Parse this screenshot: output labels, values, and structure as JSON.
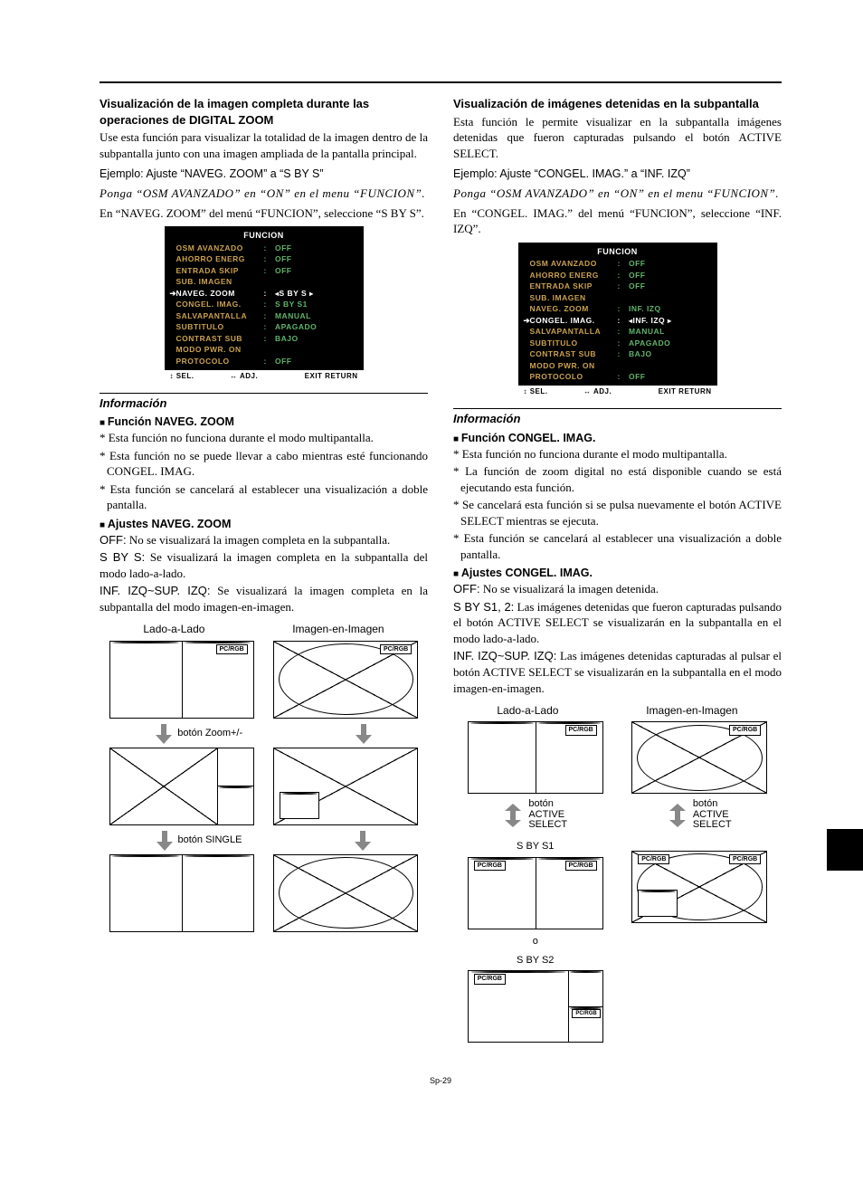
{
  "page_number": "Sp-29",
  "left": {
    "heading": "Visualización de la imagen completa durante las operaciones de DIGITAL ZOOM",
    "intro": "Use esta función para visualizar la totalidad de la imagen dentro de la subpantalla junto con una imagen ampliada de la pantalla principal.",
    "example": "Ejemplo: Ajuste “NAVEG. ZOOM” a “S BY S”",
    "italic": "Ponga “OSM AVANZADO” en “ON” en el menu “FUNCION”.",
    "select": "En “NAVEG. ZOOM” del menú “FUNCION”, seleccione “S BY S”.",
    "menu": {
      "title": "FUNCION",
      "rows": [
        {
          "label": "OSM AVANZADO",
          "value": "OFF",
          "sep": ":"
        },
        {
          "label": "AHORRO ENERG",
          "value": "OFF",
          "sep": ":"
        },
        {
          "label": "ENTRADA SKIP",
          "value": "OFF",
          "sep": ":"
        },
        {
          "label": "SUB. IMAGEN",
          "value": "",
          "sep": ""
        },
        {
          "label": "NAVEG. ZOOM",
          "value": "S BY S",
          "sep": ":",
          "hl": true,
          "arrows": true
        },
        {
          "label": "CONGEL. IMAG.",
          "value": "S BY S1",
          "sep": ":"
        },
        {
          "label": "SALVAPANTALLA",
          "value": "MANUAL",
          "sep": ":"
        },
        {
          "label": "SUBTITULO",
          "value": "APAGADO",
          "sep": ":"
        },
        {
          "label": "CONTRAST SUB",
          "value": "BAJO",
          "sep": ":"
        },
        {
          "label": "MODO PWR. ON",
          "value": "",
          "sep": ""
        },
        {
          "label": "PROTOCOLO",
          "value": "OFF",
          "sep": ":"
        }
      ],
      "foot": {
        "a": "↕ SEL.",
        "b": "↔ ADJ.",
        "c": "EXIT RETURN"
      }
    },
    "info_title": "Información",
    "sub1": "Función NAVEG. ZOOM",
    "bul": [
      "* Esta función no funciona durante el modo multipantalla.",
      "* Esta función no se puede llevar a cabo mientras esté funcionando  CONGEL. IMAG.",
      "* Esta función se cancelará al establecer una visualización a doble pantalla."
    ],
    "sub2": "Ajustes NAVEG. ZOOM",
    "opts": [
      {
        "lead": "OFF:",
        "text": " No se visualizará la imagen completa en la subpantalla."
      },
      {
        "lead": "S BY S:",
        "text": " Se visualizará la imagen completa en la subpantalla del modo lado-a-lado."
      },
      {
        "lead": "INF. IZQ~SUP. IZQ:",
        "text": " Se visualizará la imagen completa en la subpantalla del modo imagen-en-imagen."
      }
    ],
    "dlabel1": "Lado-a-Lado",
    "dlabel2": "Imagen-en-Imagen",
    "act1": "botón Zoom+/-",
    "act2": "botón SINGLE",
    "tag": "PC/RGB"
  },
  "right": {
    "heading": "Visualización de imágenes detenidas en la subpantalla",
    "intro": "Esta función le permite visualizar en la subpantalla imágenes detenidas que fueron capturadas pulsando el botón ACTIVE SELECT.",
    "example": "Ejemplo: Ajuste “CONGEL. IMAG.” a “INF. IZQ”",
    "italic": "Ponga “OSM AVANZADO” en “ON” en el menu “FUNCION”.",
    "select": "En “CONGEL. IMAG.” del menú “FUNCION”, seleccione “INF. IZQ”.",
    "menu": {
      "title": "FUNCION",
      "rows": [
        {
          "label": "OSM AVANZADO",
          "value": "OFF",
          "sep": ":"
        },
        {
          "label": "AHORRO ENERG",
          "value": "OFF",
          "sep": ":"
        },
        {
          "label": "ENTRADA SKIP",
          "value": "OFF",
          "sep": ":"
        },
        {
          "label": "SUB. IMAGEN",
          "value": "",
          "sep": ""
        },
        {
          "label": "NAVEG. ZOOM",
          "value": "INF. IZQ",
          "sep": ":"
        },
        {
          "label": "CONGEL. IMAG.",
          "value": "INF. IZQ",
          "sep": ":",
          "hl": true,
          "arrows": true
        },
        {
          "label": "SALVAPANTALLA",
          "value": "MANUAL",
          "sep": ":"
        },
        {
          "label": "SUBTITULO",
          "value": "APAGADO",
          "sep": ":"
        },
        {
          "label": "CONTRAST SUB",
          "value": "BAJO",
          "sep": ":"
        },
        {
          "label": "MODO PWR. ON",
          "value": "",
          "sep": ""
        },
        {
          "label": "PROTOCOLO",
          "value": "OFF",
          "sep": ":"
        }
      ],
      "foot": {
        "a": "↕ SEL.",
        "b": "↔ ADJ.",
        "c": "EXIT RETURN"
      }
    },
    "info_title": "Información",
    "sub1": "Función CONGEL. IMAG.",
    "bul": [
      "* Esta función no funciona durante el modo multipantalla.",
      "* La función de zoom digital no está disponible cuando se está ejecutando esta función.",
      "* Se cancelará esta función si se pulsa nuevamente el botón ACTIVE SELECT mientras se ejecuta.",
      "* Esta función se cancelará al establecer una visualización a doble pantalla."
    ],
    "sub2": "Ajustes CONGEL. IMAG.",
    "opts": [
      {
        "lead": "OFF:",
        "text": " No se visualizará la imagen detenida."
      },
      {
        "lead": "S BY S1, 2:",
        "text": " Las imágenes detenidas que fueron capturadas pulsando el botón ACTIVE SELECT se visualizarán en la subpantalla en el modo lado-a-lado."
      },
      {
        "lead": "INF. IZQ~SUP. IZQ:",
        "text": " Las imágenes detenidas capturadas al pulsar el botón ACTIVE SELECT se visualizarán en la subpantalla en el modo imagen-en-imagen."
      }
    ],
    "dlabel1": "Lado-a-Lado",
    "dlabel2": "Imagen-en-Imagen",
    "act": "botón\nACTIVE\nSELECT",
    "cap1": "S BY S1",
    "or": "o",
    "cap2": "S BY S2",
    "tag": "PC/RGB"
  }
}
